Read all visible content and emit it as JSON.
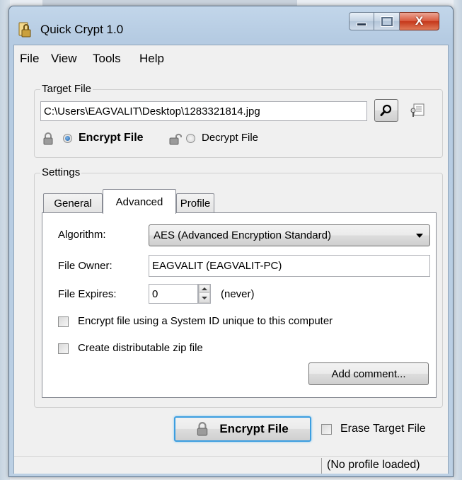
{
  "window": {
    "title": "Quick Crypt 1.0",
    "controls": {
      "minimize": "minimize",
      "maximize": "maximize",
      "close": "X"
    }
  },
  "menu": [
    "File",
    "View",
    "Tools",
    "Help"
  ],
  "target_file": {
    "group_label": "Target File",
    "path": "C:\\Users\\EAGVALIT\\Desktop\\1283321814.jpg",
    "mode_encrypt": "Encrypt File",
    "mode_decrypt": "Decrypt File",
    "selected_mode": "encrypt"
  },
  "settings": {
    "group_label": "Settings",
    "tabs": [
      "General",
      "Advanced",
      "Profile"
    ],
    "active_tab": "Advanced",
    "algorithm_label": "Algorithm:",
    "algorithm_value": "AES (Advanced Encryption Standard)",
    "owner_label": "File Owner:",
    "owner_value": "EAGVALIT (EAGVALIT-PC)",
    "expires_label": "File Expires:",
    "expires_value": "0",
    "expires_note": "(never)",
    "system_id_label": "Encrypt file using a System ID unique to this computer",
    "system_id_checked": false,
    "zip_label": "Create distributable zip file",
    "zip_checked": false,
    "comment_button": "Add comment..."
  },
  "action": {
    "button": "Encrypt File",
    "erase_label": "Erase Target File",
    "erase_checked": false
  },
  "status": {
    "text": "(No profile loaded)"
  },
  "icons": {
    "app": "quick-crypt-app-icon",
    "browse": "magnifier-icon",
    "properties": "file-properties-icon",
    "lock_closed": "lock-closed-icon",
    "lock_open": "lock-open-icon"
  },
  "colors": {
    "titlebar": "#bcd0e4",
    "close_button": "#d8573b",
    "radio_selected": "#1c5ea8",
    "face": "#f0f0f0"
  }
}
